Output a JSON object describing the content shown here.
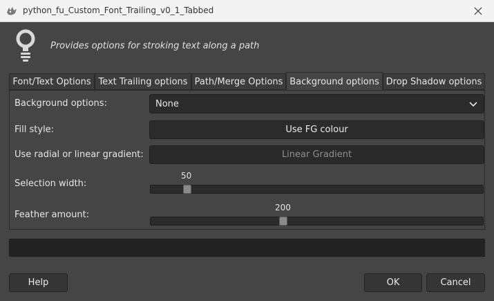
{
  "window": {
    "title": "python_fu_Custom_Font_Trailing_v0_1_Tabbed",
    "icon": "gimp-wilber-icon",
    "close_icon": "close-icon"
  },
  "header": {
    "icon": "lightbulb-icon",
    "description": "Provides options for stroking text along a path"
  },
  "tabs": [
    {
      "label": "Font/Text Options",
      "active": false
    },
    {
      "label": "Text Trailing options",
      "active": false
    },
    {
      "label": "Path/Merge Options",
      "active": false
    },
    {
      "label": "Background options",
      "active": true
    },
    {
      "label": "Drop Shadow options",
      "active": false
    }
  ],
  "form": {
    "background_options": {
      "label": "Background options:",
      "value": "None"
    },
    "fill_style": {
      "label": "Fill style:",
      "value": "Use FG colour"
    },
    "gradient": {
      "label": "Use radial or linear gradient:",
      "value": "Linear Gradient"
    },
    "selection_width": {
      "label": "Selection width:",
      "value": "50",
      "fraction": 0.11
    },
    "feather_amount": {
      "label": "Feather amount:",
      "value": "200",
      "fraction": 0.4
    }
  },
  "buttons": {
    "help": "Help",
    "ok": "OK",
    "cancel": "Cancel"
  },
  "colors": {
    "background": "#454545",
    "widget": "#2b2b2b",
    "progress": "#232323"
  }
}
